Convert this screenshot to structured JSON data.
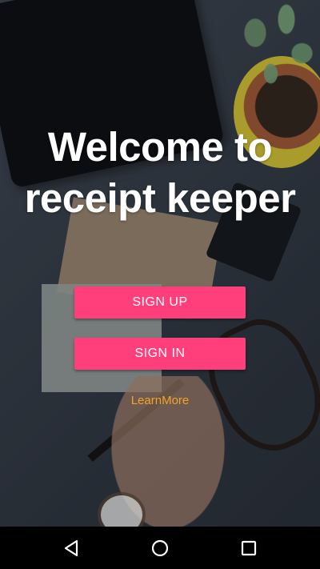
{
  "welcome": {
    "title": "Welcome to receipt keeper"
  },
  "actions": {
    "sign_up_label": "SIGN UP",
    "sign_in_label": "SIGN IN",
    "learn_more_label": "LearnMore"
  },
  "navigation": {
    "back_icon": "back-triangle-icon",
    "home_icon": "home-circle-icon",
    "recents_icon": "recents-square-icon"
  },
  "colors": {
    "accent": "#ff3f7c",
    "link": "#f4a425",
    "title": "#ffffff",
    "nav_background": "#000000"
  }
}
